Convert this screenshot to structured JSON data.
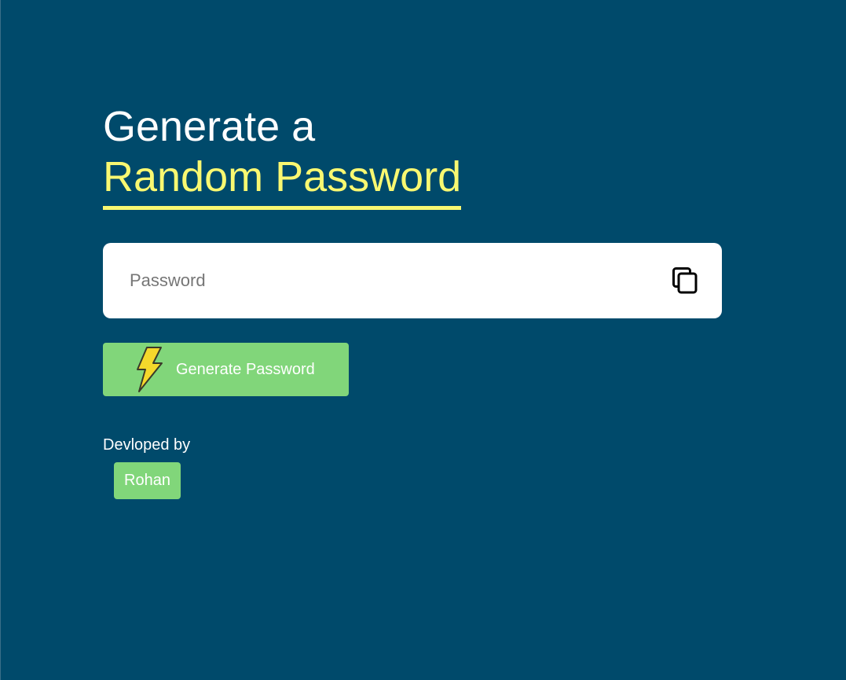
{
  "heading": {
    "line1": "Generate a",
    "line2": "Random Password"
  },
  "password": {
    "placeholder": "Password",
    "value": "",
    "copy_icon": "copy-icon"
  },
  "generate_button": {
    "icon": "lightning-bolt-icon",
    "label": "Generate Password"
  },
  "footer": {
    "developed_label": "Devloped by",
    "developer_name": "Rohan"
  },
  "colors": {
    "background": "#004a6b",
    "accent_yellow": "#f9f871",
    "button_green": "#81d67a",
    "input_background": "#ffffff"
  }
}
